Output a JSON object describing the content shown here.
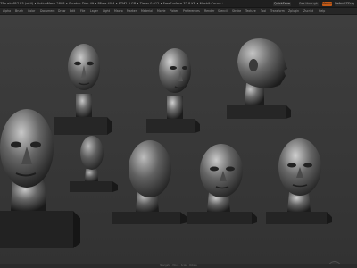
{
  "app": {
    "title": "ZBrush 4R7 P3 (x64) • ActiveMesh 2898 • Scratch Disk 49 • PFree 40.4 • FTM2.3 GB • Timer 0.012 • FreeSurface 32.8 KB • Mesh9 Count: 9 • Quicksave In 37 Secs"
  },
  "titlebar_buttons": {
    "quicksave": "QuickSave",
    "see_through": "See-through 0",
    "menus": "Menus",
    "default_zscript": "DefaultZScript"
  },
  "menu": {
    "items": [
      "Alpha",
      "Brush",
      "Color",
      "Document",
      "Draw",
      "Edit",
      "File",
      "Layer",
      "Light",
      "Macro",
      "Marker",
      "Material",
      "Movie",
      "Picker",
      "Preferences",
      "Render",
      "Stencil",
      "Stroke",
      "Texture",
      "Tool",
      "Transform",
      "Zplugin",
      "Zscript",
      "Help"
    ]
  },
  "statusbar": {
    "text": "Navigate · Move · Scale · Rotate"
  },
  "colors": {
    "viewport_bg": "#3a3a3a",
    "accent": "#c45a17",
    "clay": "#8a8a8a"
  },
  "icons": {
    "nav_gizmo": "navigation-gizmo-icon"
  }
}
